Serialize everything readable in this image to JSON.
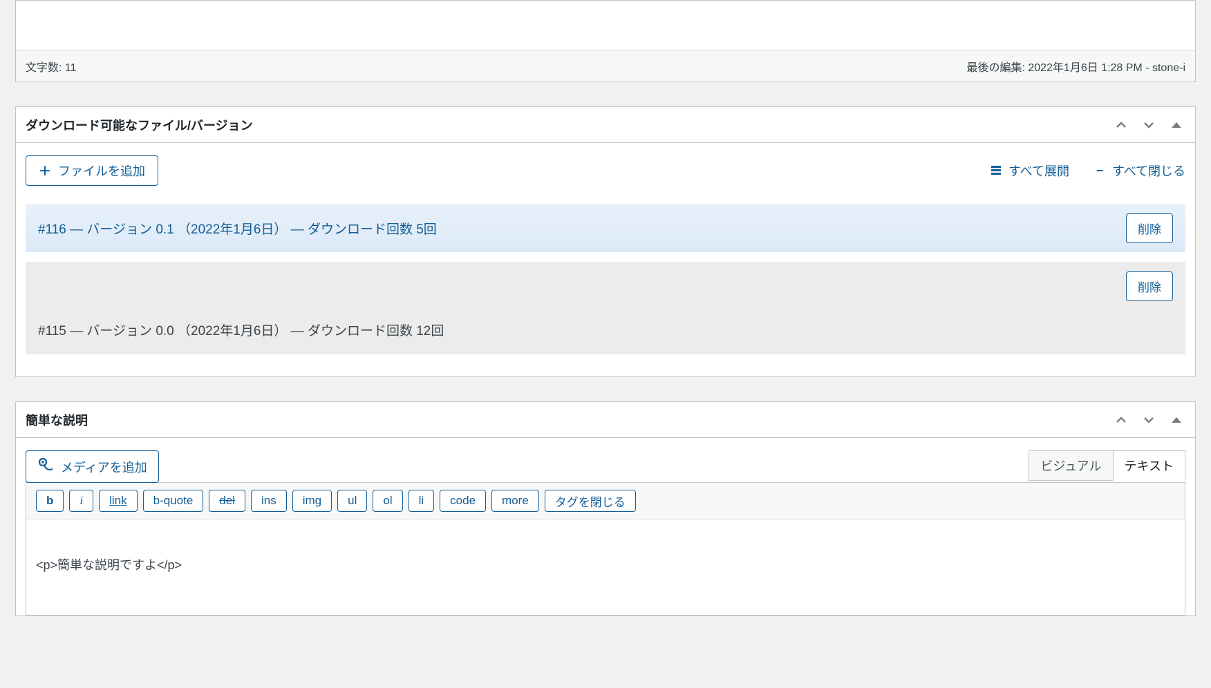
{
  "editor_status": {
    "word_count_label": "文字数: 11",
    "last_edit_label": "最後の編集: 2022年1月6日 1:28 PM - stone-i"
  },
  "downloads_panel": {
    "title": "ダウンロード可能なファイル/バージョン",
    "add_file_label": "ファイルを追加",
    "expand_all_label": "すべて展開",
    "collapse_all_label": "すべて閉じる",
    "delete_label": "削除",
    "rows": [
      {
        "label": "#116 — バージョン 0.1 （2022年1月6日） — ダウンロード回数 5回"
      },
      {
        "label": "#115 — バージョン 0.0 （2022年1月6日） — ダウンロード回数 12回"
      }
    ]
  },
  "desc_panel": {
    "title": "簡単な説明",
    "add_media_label": "メディアを追加",
    "tab_visual": "ビジュアル",
    "tab_text": "テキスト",
    "quicktags": {
      "b": "b",
      "i": "i",
      "link": "link",
      "bquote": "b-quote",
      "del": "del",
      "ins": "ins",
      "img": "img",
      "ul": "ul",
      "ol": "ol",
      "li": "li",
      "code": "code",
      "more": "more",
      "close": "タグを閉じる"
    },
    "content": "<p>簡単な説明ですよ</p>"
  }
}
